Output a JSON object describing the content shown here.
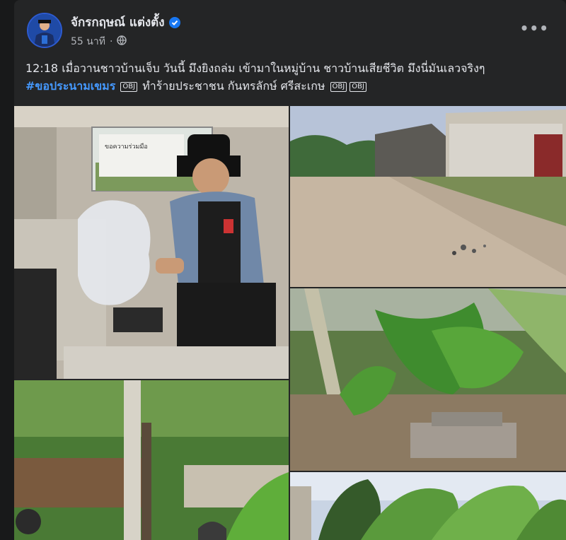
{
  "post": {
    "author": "จักรกฤษณ์ แต่งตั้ง",
    "time": "55 นาที",
    "privacy_icon": "globe-icon",
    "more_label": "•••",
    "text": {
      "line1": "12:18 เมื่อวานชาวบ้านเจ็บ วันนี้ มึงยิงถล่ม เข้ามาในหมู่บ้าน ชาวบ้านเสียชีวิต มึงนี่มันเลวจริงๆ",
      "hashtag": "#ขอประนามเขมร",
      "flag1": "OBJ",
      "middle": "ทำร้ายประชาชน  กันทรลักษ์ ศรีสะเกษ",
      "flag2": "OBJ",
      "flag3": "OBJ"
    }
  },
  "photos": {
    "van_sign": "ขอความร่วมมือ"
  },
  "colors": {
    "background": "#242526",
    "text": "#e4e6eb",
    "link": "#4599ff",
    "muted": "#b0b3b8"
  }
}
